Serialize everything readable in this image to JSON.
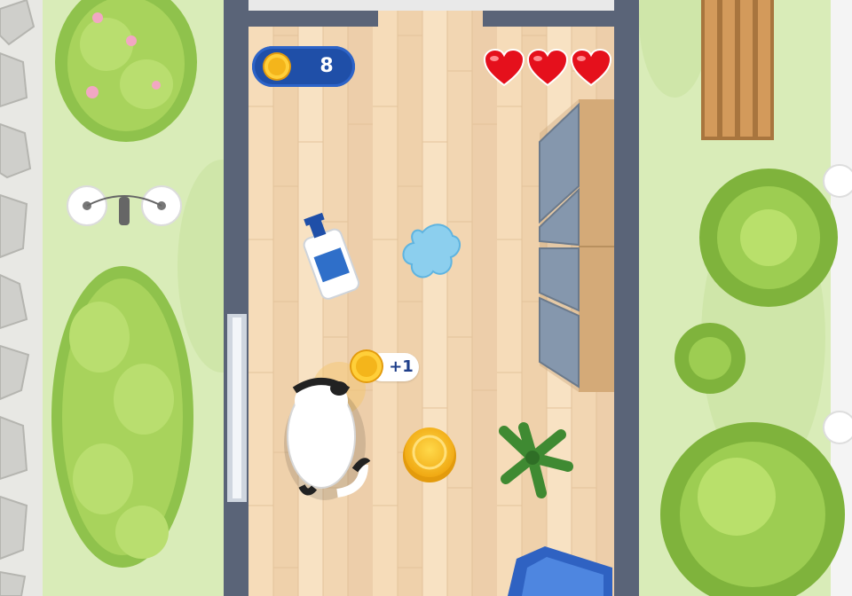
{
  "hud": {
    "coins": "8",
    "lives": 3,
    "heart_color": "#e5101c"
  },
  "popup": {
    "text": "+1"
  },
  "scene": {
    "items": [
      "hand-sanitizer-bottle",
      "water-splash",
      "gold-coin",
      "potted-plant",
      "cat-player",
      "blue-armchair",
      "cabinet",
      "bench",
      "bushes",
      "stones"
    ]
  },
  "colors": {
    "grass": "#d9ecb8",
    "floor": "#f3d9b5",
    "wall": "#5a6478",
    "coin": "#f4b51b",
    "hud_bg": "#1f4fa8"
  }
}
